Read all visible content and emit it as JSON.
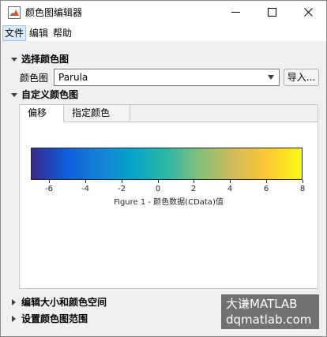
{
  "window": {
    "title": "颜色图编辑器",
    "app_icon": "matlab-logo-icon",
    "controls": {
      "minimize": "minimize-icon",
      "maximize": "maximize-icon",
      "close": "close-icon"
    }
  },
  "menubar": {
    "items": [
      {
        "label": "文件"
      },
      {
        "label": "编辑"
      },
      {
        "label": "帮助"
      }
    ]
  },
  "select_section": {
    "title": "选择颜色图",
    "colormap_label": "颜色图",
    "colormap_value": "Parula",
    "import_label": "导入..."
  },
  "custom_section": {
    "title": "自定义颜色图",
    "tabs": [
      {
        "label": "偏移",
        "active": true
      },
      {
        "label": "指定颜色",
        "active": false
      }
    ]
  },
  "chart_data": {
    "type": "heatmap",
    "colormap": "Parula",
    "x": [
      -6,
      -4,
      -2,
      0,
      2,
      4,
      6,
      8
    ],
    "tick_labels": [
      "-6",
      "-4",
      "-2",
      "0",
      "2",
      "4",
      "6",
      "8"
    ],
    "xlim": [
      -7,
      8
    ],
    "xlabel": "Figure 1 - 颜色数据(CData)值",
    "colors": [
      "#352a87",
      "#0f5cdd",
      "#1481d6",
      "#06a4ca",
      "#2eb7a4",
      "#87bf77",
      "#d1bb59",
      "#fec832",
      "#f9fb0e"
    ]
  },
  "collapsed_sections": [
    {
      "title": "编辑大小和颜色空间"
    },
    {
      "title": "设置颜色图范围"
    }
  ],
  "watermark": {
    "line1": "大谦MATLAB",
    "line2": "dqmatlab.com"
  }
}
